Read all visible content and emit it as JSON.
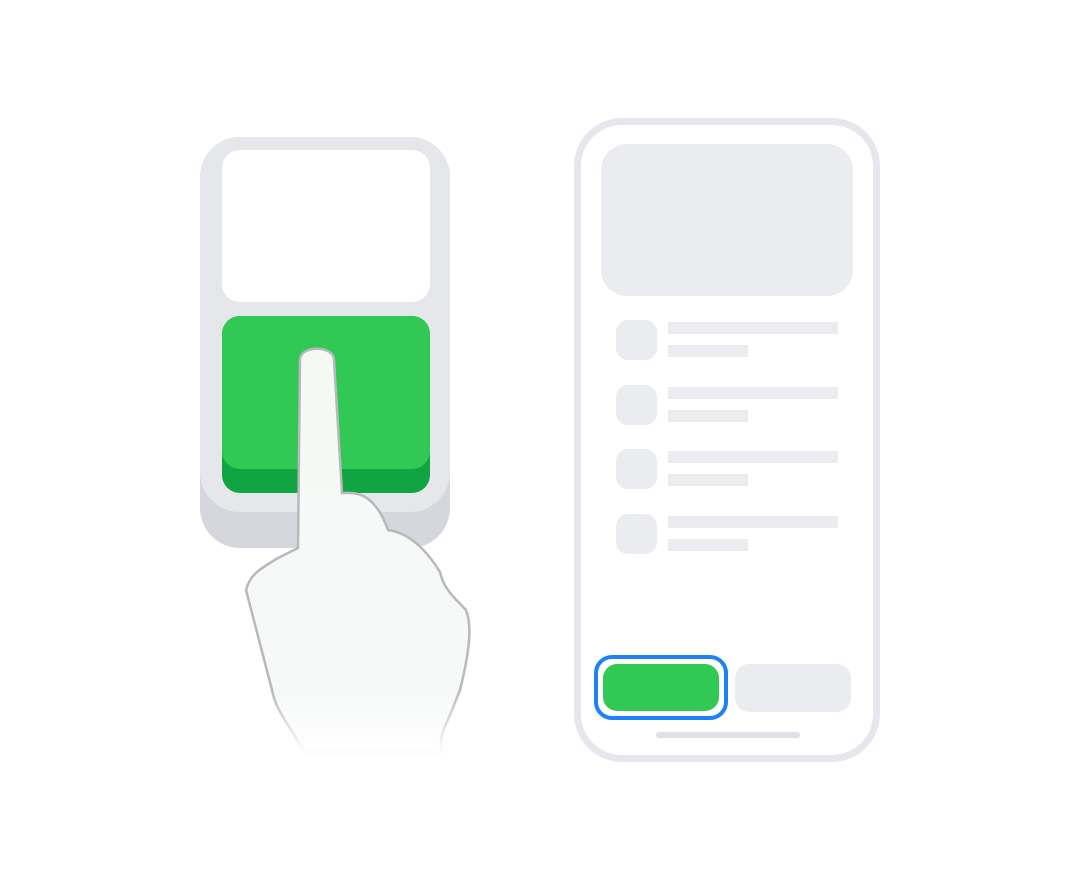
{
  "colors": {
    "background": "#ffffff",
    "switch_body": "#d5d7dc",
    "switch_face": "#e6e7eb",
    "switch_button": "#31c853",
    "switch_button_shadow": "#10a442",
    "phone_frame": "#e5e7ec",
    "placeholder": "#ebecf0",
    "focus_ring": "#1d82f5",
    "hand_fill": "#f7f8f8",
    "hand_outline": "#b8b9bc"
  },
  "switch_device": {
    "icon": "accessibility-switch-icon",
    "pressed_by": "hand-pointing-icon"
  },
  "phone": {
    "list_rows": 4,
    "focused_button": "primary-action",
    "buttons": [
      "primary-action",
      "secondary-action"
    ]
  }
}
